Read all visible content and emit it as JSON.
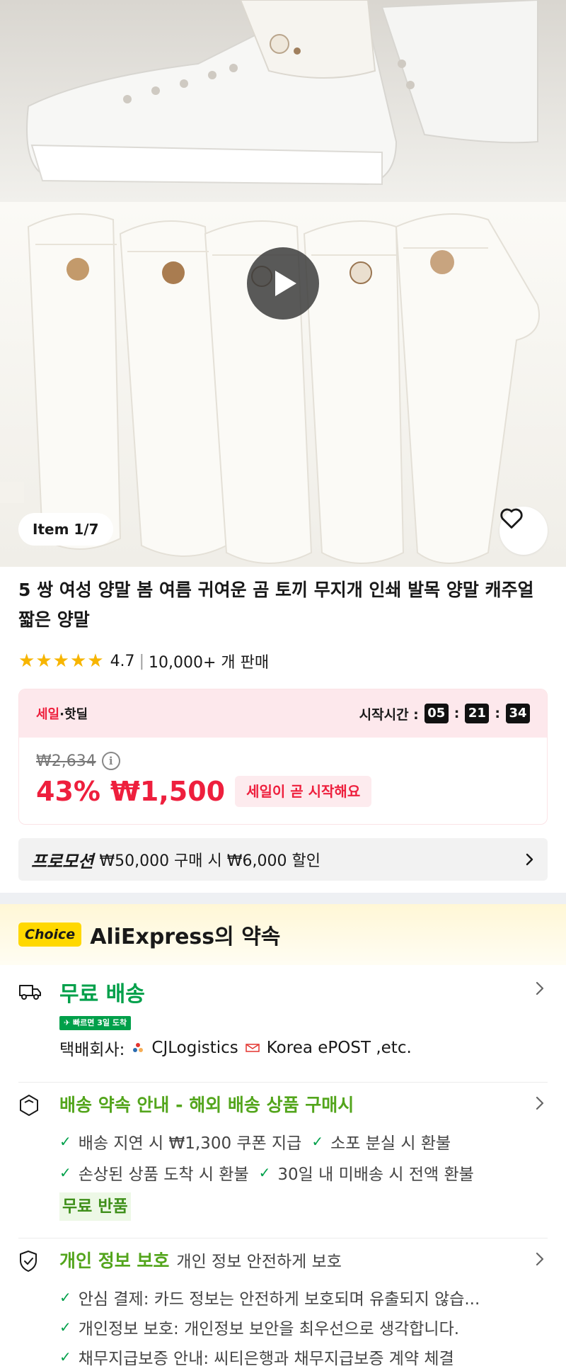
{
  "gallery": {
    "item_counter": "Item 1/7",
    "video_available": true
  },
  "product": {
    "title": "5 쌍 여성 양말 봄 여름 귀여운 곰 토끼 무지개 인쇄 발목 양말 캐주얼 짧은 양말",
    "rating": "4.7",
    "stars": 5,
    "sold": "10,000+ 개 판매"
  },
  "sale": {
    "label_red": "세일",
    "label_dot": "·",
    "label_rest": "핫딜",
    "timer_label": "시작시간 :",
    "hours": "05",
    "minutes": "21",
    "seconds": "34",
    "original_price": "₩2,634",
    "discount": "43%",
    "price": "₩1,500",
    "soon_text": "세일이 곧 시작해요"
  },
  "promotion": {
    "title": "프로모션",
    "text": "₩50,000 구매 시 ₩6,000 할인"
  },
  "choice": {
    "badge": "Choice",
    "title": "AliExpress의 약속"
  },
  "shipping": {
    "title": "무료 배송",
    "fast_badge": "✈ 빠르면 3일 도착",
    "courier_label": "택배회사:",
    "courier_1": "CJLogistics",
    "courier_2": "Korea ePOST ,etc."
  },
  "delivery_promise": {
    "title": "배송 약속 안내 - 해외 배송 상품 구매시",
    "items": [
      "배송 지연 시 ₩1,300 쿠폰 지급",
      "소포 분실 시 환불",
      "손상된 상품 도착 시 환불",
      "30일 내 미배송 시 전액 환불"
    ],
    "free_return": "무료 반품"
  },
  "privacy": {
    "title": "개인 정보 보호",
    "subtitle": "개인 정보 안전하게 보호",
    "items": [
      "안심 결제: 카드 정보는 안전하게 보호되며 유출되지 않습...",
      "개인정보 보호: 개인정보 보안을 최우선으로 생각합니다.",
      "채무지급보증 안내: 씨티은행과 채무지급보증 계약 체결"
    ]
  },
  "colors": {
    "sale_red": "#ee1f3d",
    "choice_yellow": "#ffd800",
    "green": "#00a04a",
    "star": "#f7b500"
  }
}
